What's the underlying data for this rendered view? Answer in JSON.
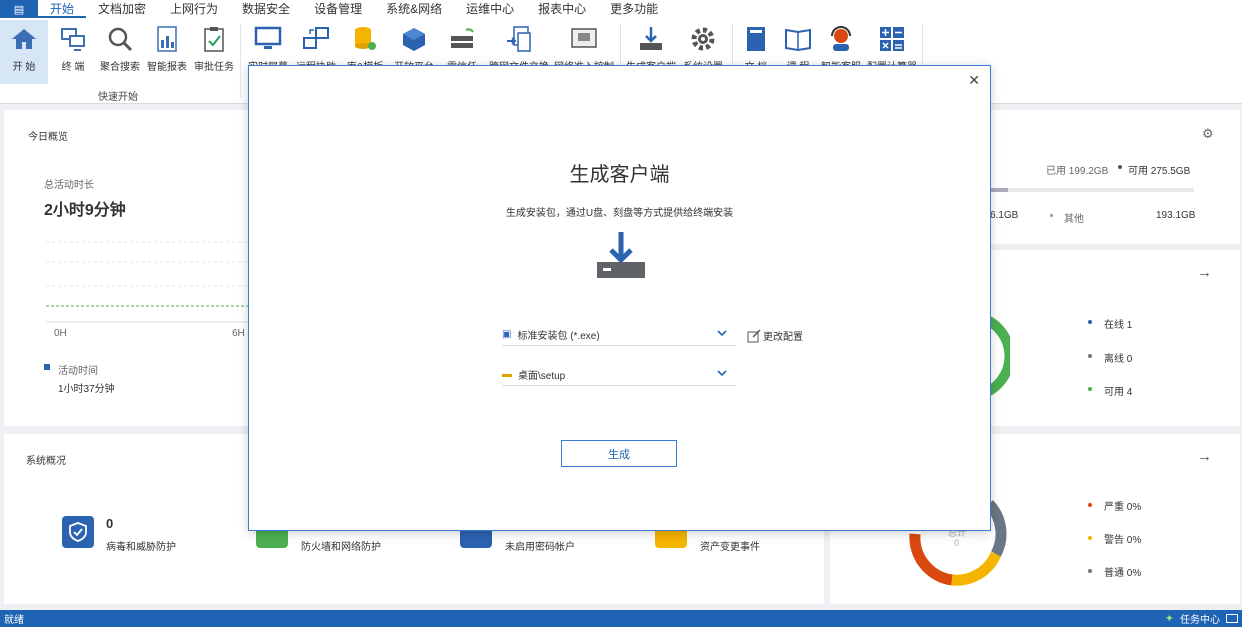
{
  "menu": {
    "app_icon": "app-menu-icon",
    "items": [
      {
        "label": "开始",
        "active": true
      },
      {
        "label": "文档加密"
      },
      {
        "label": "上网行为"
      },
      {
        "label": "数据安全"
      },
      {
        "label": "设备管理"
      },
      {
        "label": "系统&网络"
      },
      {
        "label": "运维中心"
      },
      {
        "label": "报表中心"
      },
      {
        "label": "更多功能"
      }
    ]
  },
  "ribbon": {
    "group_label": "快速开始",
    "buttons": [
      {
        "label": "开 始",
        "icon": "home-icon"
      },
      {
        "label": "终 端",
        "icon": "terminals-icon"
      },
      {
        "label": "聚合搜索",
        "icon": "search-icon"
      },
      {
        "label": "智能报表",
        "icon": "report-icon"
      },
      {
        "label": "审批任务",
        "icon": "approval-icon"
      },
      {
        "label": "实时屏幕",
        "icon": "monitor-icon"
      },
      {
        "label": "远程协助",
        "icon": "remote-icon"
      },
      {
        "label": "库&模板",
        "icon": "database-icon"
      },
      {
        "label": "开放平台",
        "icon": "cube-icon"
      },
      {
        "label": "零信任",
        "icon": "zero-trust-icon"
      },
      {
        "label": "跨网文件交换",
        "icon": "file-exchange-icon"
      },
      {
        "label": "网络准入控制",
        "icon": "network-access-icon"
      },
      {
        "label": "生成客户端",
        "icon": "download-icon"
      },
      {
        "label": "系统设置",
        "icon": "gear-icon"
      },
      {
        "label": "文 档",
        "icon": "document-icon"
      },
      {
        "label": "课 程",
        "icon": "book-icon"
      },
      {
        "label": "智能客服",
        "icon": "support-icon"
      },
      {
        "label": "配置计算器",
        "icon": "calculator-icon"
      }
    ]
  },
  "today": {
    "title": "今日概览",
    "total_label": "总活动时长",
    "total_value": "2小时9分钟",
    "axis_0": "0H",
    "axis_6": "6H",
    "legend": "活动时间",
    "legend_value": "1小时37分钟"
  },
  "storage": {
    "used_label": "已用 199.2GB",
    "free_label": "可用 275.5GB",
    "partial_value": "6.1GB",
    "other_label": "其他",
    "other_value": "193.1GB"
  },
  "terminals": {
    "online": "在线 1",
    "offline": "离线 0",
    "available": "可用 4"
  },
  "system": {
    "title": "系统概况",
    "count": "0",
    "items": [
      "病毒和威胁防护",
      "防火墙和网络防护",
      "未启用密码帐户",
      "资产变更事件"
    ]
  },
  "alerts": {
    "severe": "严重  0%",
    "warning": "警告  0%",
    "normal": "普通  0%",
    "center_label": "总计",
    "center_value": "0"
  },
  "dialog": {
    "title": "生成客户端",
    "subtitle": "生成安装包，通过U盘、刻盘等方式提供给终端安装",
    "package_type": "标准安装包 (*.exe)",
    "path": "桌面\\setup",
    "edit_config": "更改配置",
    "generate": "生成"
  },
  "statusbar": {
    "status": "就绪",
    "task_center": "任务中心"
  },
  "colors": {
    "primary": "#1f63b5",
    "green": "#4caf50",
    "orange": "#f5a623",
    "red": "#d9480f",
    "gray": "#6b7785"
  }
}
